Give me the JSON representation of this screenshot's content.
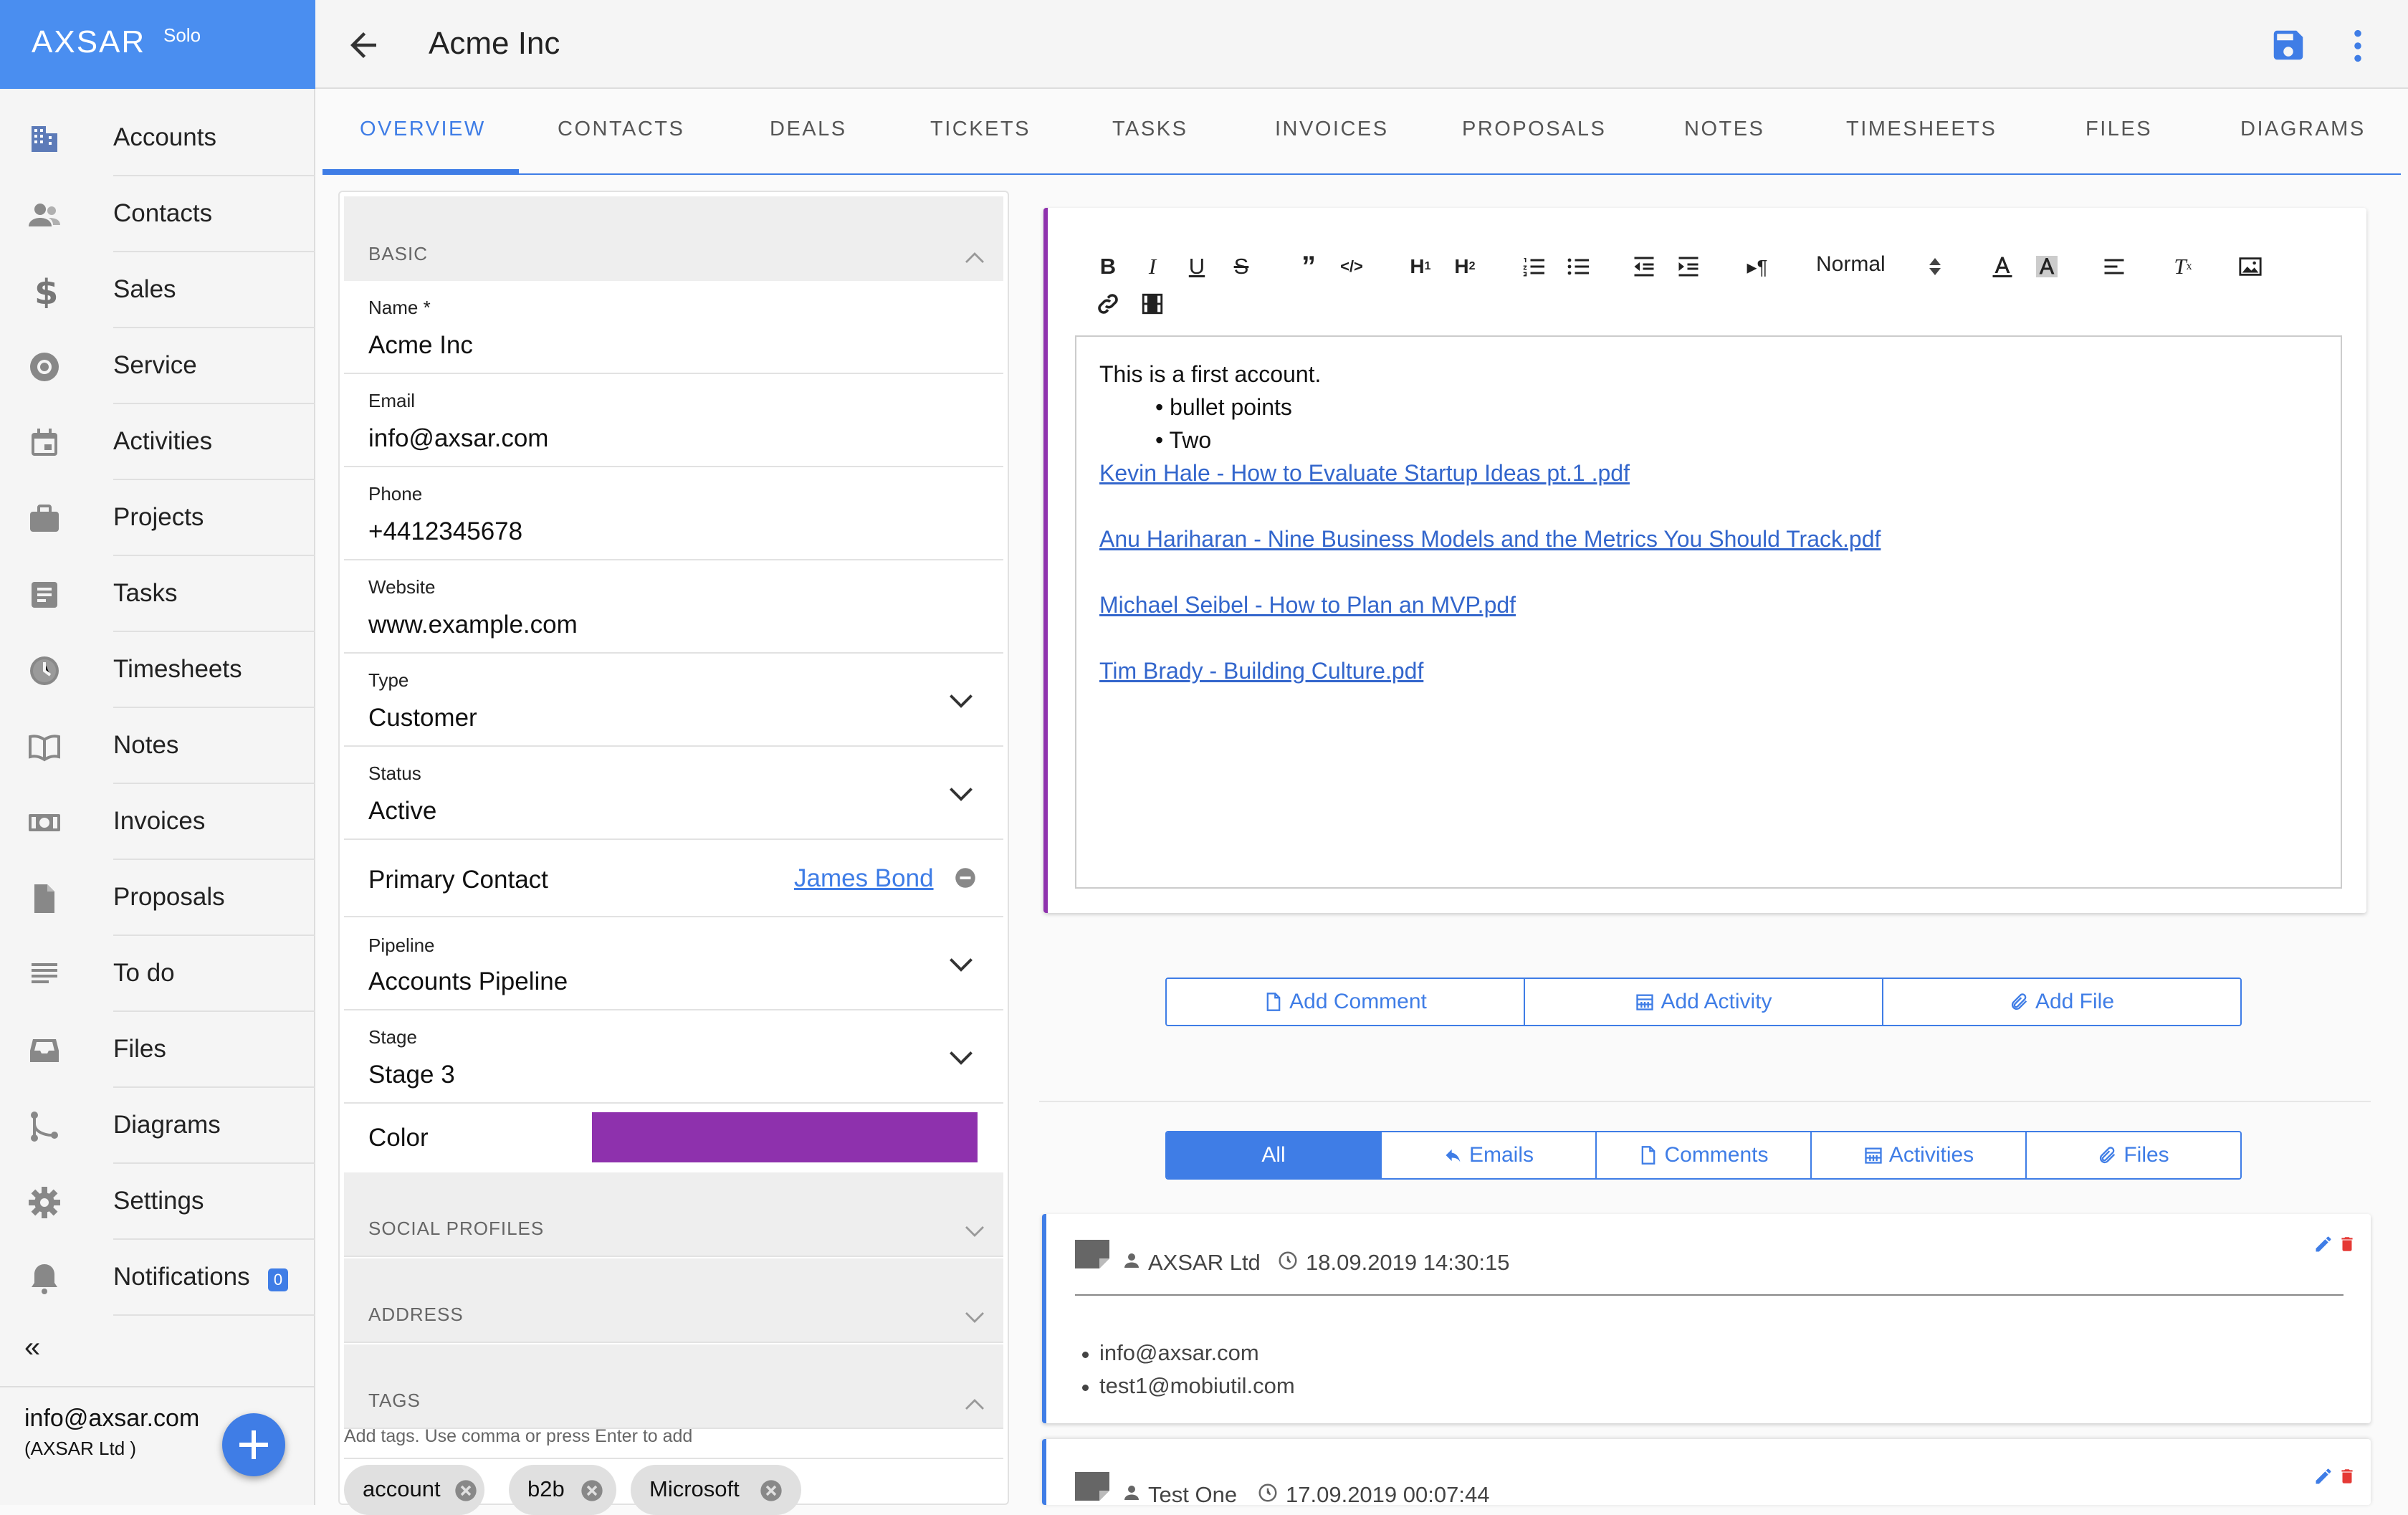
{
  "brand": {
    "name": "AXSAR",
    "plan": "Solo"
  },
  "sidebar": {
    "items": [
      {
        "label": "Accounts",
        "icon": "building-icon"
      },
      {
        "label": "Contacts",
        "icon": "contacts-icon"
      },
      {
        "label": "Sales",
        "icon": "dollar-icon"
      },
      {
        "label": "Service",
        "icon": "lifebuoy-icon"
      },
      {
        "label": "Activities",
        "icon": "calendar-icon"
      },
      {
        "label": "Projects",
        "icon": "briefcase-icon"
      },
      {
        "label": "Tasks",
        "icon": "task-list-icon"
      },
      {
        "label": "Timesheets",
        "icon": "clock-icon"
      },
      {
        "label": "Notes",
        "icon": "book-icon"
      },
      {
        "label": "Invoices",
        "icon": "money-icon"
      },
      {
        "label": "Proposals",
        "icon": "document-icon"
      },
      {
        "label": "To do",
        "icon": "lines-icon"
      },
      {
        "label": "Files",
        "icon": "inbox-icon"
      },
      {
        "label": "Diagrams",
        "icon": "diagram-icon"
      },
      {
        "label": "Settings",
        "icon": "gear-icon"
      },
      {
        "label": "Notifications",
        "icon": "bell-icon",
        "badge": "0"
      }
    ],
    "collapse": "«",
    "user_email": "info@axsar.com",
    "user_org": "(AXSAR Ltd    )"
  },
  "header": {
    "title": "Acme Inc"
  },
  "tabs": [
    "OVERVIEW",
    "CONTACTS",
    "DEALS",
    "TICKETS",
    "TASKS",
    "INVOICES",
    "PROPOSALS",
    "NOTES",
    "TIMESHEETS",
    "FILES",
    "DIAGRAMS"
  ],
  "form": {
    "basic_title": "BASIC",
    "name": {
      "label": "Name *",
      "value": "Acme Inc"
    },
    "email": {
      "label": "Email",
      "value": "info@axsar.com"
    },
    "phone": {
      "label": "Phone",
      "value": "+4412345678"
    },
    "website": {
      "label": "Website",
      "value": "www.example.com"
    },
    "type": {
      "label": "Type",
      "value": "Customer"
    },
    "status": {
      "label": "Status",
      "value": "Active"
    },
    "primary_contact": {
      "label": "Primary Contact",
      "value": "James Bond"
    },
    "pipeline": {
      "label": "Pipeline",
      "value": "Accounts Pipeline"
    },
    "stage": {
      "label": "Stage",
      "value": "Stage 3"
    },
    "color": {
      "label": "Color",
      "value": "#8e31ad"
    },
    "social_title": "SOCIAL PROFILES",
    "address_title": "ADDRESS",
    "tags_title": "TAGS",
    "tags_hint": "Add tags. Use comma or press Enter to add",
    "tags": [
      "account",
      "b2b",
      "Microsoft"
    ]
  },
  "editor": {
    "format": "Normal",
    "text": "This is a first account.",
    "bullets": [
      "bullet points",
      "Two"
    ],
    "links": [
      "Kevin Hale - How to Evaluate Startup Ideas pt.1 .pdf",
      "Anu Hariharan - Nine Business Models and the Metrics You Should Track.pdf",
      "Michael Seibel - How to Plan an MVP.pdf",
      "Tim Brady - Building Culture.pdf"
    ]
  },
  "actions": {
    "add_comment": "Add Comment",
    "add_activity": "Add Activity",
    "add_file": "Add File"
  },
  "filters": {
    "all": "All",
    "emails": "Emails",
    "comments": "Comments",
    "activities": "Activities",
    "files": "Files"
  },
  "timeline": [
    {
      "author": "AXSAR Ltd",
      "time": "18.09.2019 14:30:15",
      "recipients": [
        "info@axsar.com",
        "test1@mobiutil.com"
      ]
    },
    {
      "author": "Test One",
      "time": "17.09.2019 00:07:44"
    }
  ],
  "colors": {
    "accent": "#3f7de6",
    "brand": "#4a8ef0",
    "purple": "#8e31ad",
    "danger": "#e53935"
  }
}
